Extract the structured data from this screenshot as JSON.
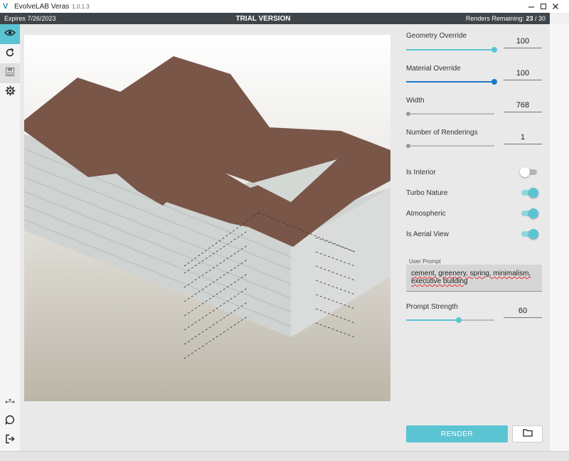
{
  "window": {
    "app_name": "EvolveLAB Veras",
    "version": "1.0.1.3",
    "controls": [
      "minimize-icon",
      "maximize-icon",
      "close-icon"
    ]
  },
  "status": {
    "expires": "Expires 7/26/2023",
    "banner": "TRIAL VERSION",
    "renders_label": "Renders Remaining:",
    "renders_used": "23",
    "renders_total": "/ 30"
  },
  "toolbar": {
    "items": [
      "eye-icon",
      "refresh-icon",
      "save-icon",
      "gear-icon"
    ],
    "bottom_items": [
      "share-icon",
      "chat-icon",
      "logout-icon"
    ]
  },
  "settings": {
    "geometry_override": {
      "label": "Geometry Override",
      "value": "100",
      "level": 1.0
    },
    "material_override": {
      "label": "Material Override",
      "value": "100",
      "level": 1.0
    },
    "width": {
      "label": "Width",
      "value": "768",
      "level": 0.0
    },
    "num_renderings": {
      "label": "Number of Renderings",
      "value": "1",
      "level": 0.0
    },
    "is_interior": {
      "label": "Is Interior",
      "on": false
    },
    "turbo_nature": {
      "label": "Turbo Nature",
      "on": true
    },
    "atmospheric": {
      "label": "Atmospheric",
      "on": true
    },
    "is_aerial_view": {
      "label": "Is Aerial View",
      "on": true
    },
    "user_prompt": {
      "label": "User Prompt",
      "value": "cement, greenery, spring, minimalism, executive building"
    },
    "prompt_strength": {
      "label": "Prompt Strength",
      "value": "60",
      "level": 0.6
    }
  },
  "actions": {
    "render_label": "RENDER"
  },
  "colors": {
    "accent": "#5bc4d3",
    "material_accent": "#1f78c8",
    "roof": "#7a5648",
    "status_bg": "#3f4448"
  }
}
